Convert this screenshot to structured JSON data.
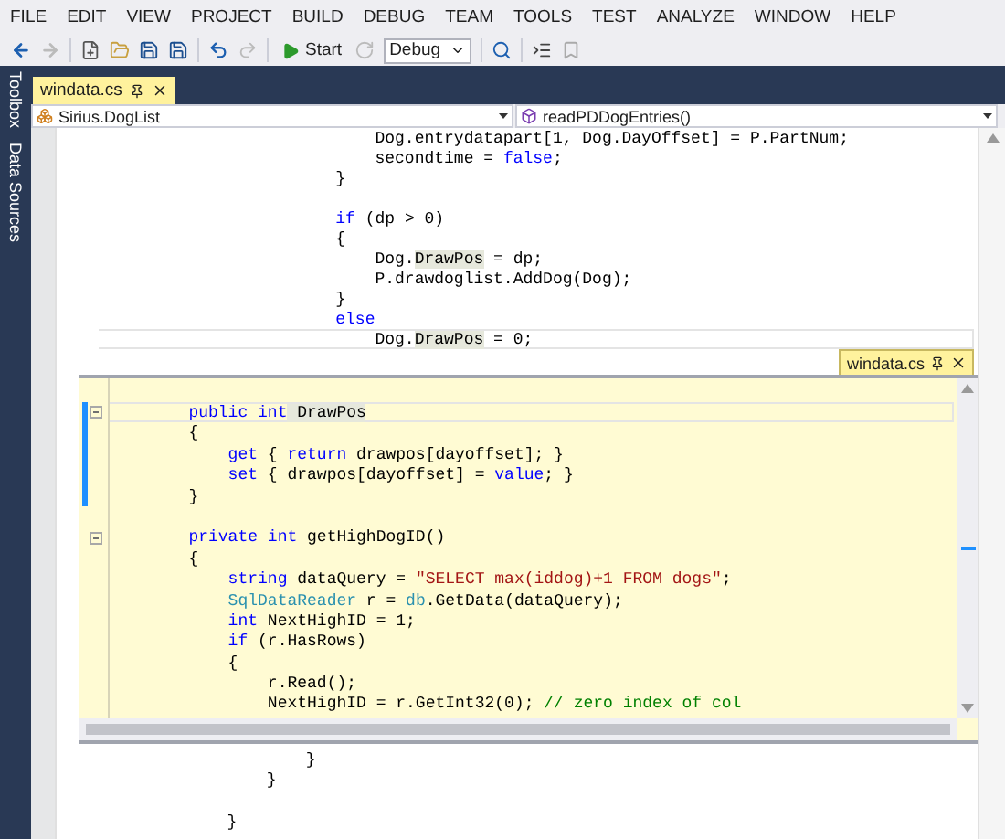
{
  "menu": [
    "FILE",
    "EDIT",
    "VIEW",
    "PROJECT",
    "BUILD",
    "DEBUG",
    "TEAM",
    "TOOLS",
    "TEST",
    "ANALYZE",
    "WINDOW",
    "HELP"
  ],
  "toolbar": {
    "start_label": "Start",
    "configuration": "Debug"
  },
  "side_tabs": [
    "Toolbox",
    "Data Sources"
  ],
  "document_tab": {
    "label": "windata.cs",
    "selected": true
  },
  "navigation": {
    "type": "Sirius.DogList",
    "member": "readPDDogEntries()"
  },
  "editor_lines": [
    {
      "current": false,
      "tokens": [
        {
          "text": "                            Dog.entrydatapart[1, Dog.DayOffset] = P.PartNum;",
          "kind": "plain"
        }
      ]
    },
    {
      "current": false,
      "tokens": [
        {
          "text": "                            secondtime = ",
          "kind": "plain"
        },
        {
          "text": "false",
          "kind": "keyword"
        },
        {
          "text": ";",
          "kind": "plain"
        }
      ]
    },
    {
      "current": false,
      "tokens": [
        {
          "text": "                        }",
          "kind": "plain"
        }
      ]
    },
    {
      "current": false
    },
    {
      "current": false,
      "tokens": [
        {
          "text": "                        if",
          "kind": "keyword"
        },
        {
          "text": " (dp > 0)",
          "kind": "plain"
        }
      ]
    },
    {
      "current": false,
      "tokens": [
        {
          "text": "                        {",
          "kind": "plain"
        }
      ]
    },
    {
      "current": false,
      "tokens": [
        {
          "text": "                            Dog.",
          "kind": "plain"
        },
        {
          "text": "DrawPos",
          "kind": "reference"
        },
        {
          "text": " = dp;",
          "kind": "plain"
        }
      ]
    },
    {
      "current": false,
      "tokens": [
        {
          "text": "                            P.drawdoglist.AddDog(Dog);",
          "kind": "plain"
        }
      ]
    },
    {
      "current": false,
      "tokens": [
        {
          "text": "                        }",
          "kind": "plain"
        }
      ]
    },
    {
      "current": false,
      "tokens": [
        {
          "text": "                        else",
          "kind": "keyword"
        }
      ]
    },
    {
      "current": true,
      "tokens": [
        {
          "text": "                            Dog.",
          "kind": "plain"
        },
        {
          "text": "DrawPos",
          "kind": "reference"
        },
        {
          "text": " = 0;",
          "kind": "plain"
        }
      ]
    }
  ],
  "peek": {
    "title": "windata.cs",
    "lines": [
      {
        "current": true,
        "changed": true,
        "expanded": true,
        "tokens": [
          {
            "text": "        public",
            "kind": "keyword"
          },
          {
            "text": " int",
            "kind": "keyword"
          },
          {
            "text": " DrawPos",
            "kind": "reference"
          }
        ]
      },
      {
        "current": false,
        "changed": true,
        "tokens": [
          {
            "text": "        {",
            "kind": "plain"
          }
        ]
      },
      {
        "current": false,
        "changed": true,
        "tokens": [
          {
            "text": "            get",
            "kind": "keyword"
          },
          {
            "text": " { ",
            "kind": "plain"
          },
          {
            "text": "return",
            "kind": "keyword"
          },
          {
            "text": " drawpos[dayoffset]; }",
            "kind": "plain"
          }
        ]
      },
      {
        "current": false,
        "changed": true,
        "tokens": [
          {
            "text": "            set",
            "kind": "keyword"
          },
          {
            "text": " { drawpos[dayoffset] = ",
            "kind": "plain"
          },
          {
            "text": "value",
            "kind": "keyword"
          },
          {
            "text": "; }",
            "kind": "plain"
          }
        ]
      },
      {
        "current": false,
        "changed": true,
        "tokens": [
          {
            "text": "        }",
            "kind": "plain"
          }
        ]
      },
      {
        "current": false,
        "changed": false
      },
      {
        "current": false,
        "changed": false,
        "expanded": true,
        "tokens": [
          {
            "text": "        private",
            "kind": "keyword"
          },
          {
            "text": " int",
            "kind": "keyword"
          },
          {
            "text": " getHighDogID()",
            "kind": "plain"
          }
        ]
      },
      {
        "current": false,
        "changed": false,
        "tokens": [
          {
            "text": "        {",
            "kind": "plain"
          }
        ]
      },
      {
        "current": false,
        "changed": false,
        "tokens": [
          {
            "text": "            string",
            "kind": "keyword"
          },
          {
            "text": " dataQuery = ",
            "kind": "plain"
          },
          {
            "text": "\"SELECT max(iddog)+1 FROM dogs\"",
            "kind": "string"
          },
          {
            "text": ";",
            "kind": "plain"
          }
        ]
      },
      {
        "current": false,
        "changed": false,
        "tokens": [
          {
            "text": "            SqlDataReader",
            "kind": "type"
          },
          {
            "text": " r = ",
            "kind": "plain"
          },
          {
            "text": "db",
            "kind": "type"
          },
          {
            "text": ".GetData(dataQuery);",
            "kind": "plain"
          }
        ]
      },
      {
        "current": false,
        "changed": false,
        "tokens": [
          {
            "text": "            int",
            "kind": "keyword"
          },
          {
            "text": " NextHighID = 1;",
            "kind": "plain"
          }
        ]
      },
      {
        "current": false,
        "changed": false,
        "tokens": [
          {
            "text": "            if",
            "kind": "keyword"
          },
          {
            "text": " (r.HasRows)",
            "kind": "plain"
          }
        ]
      },
      {
        "current": false,
        "changed": false,
        "tokens": [
          {
            "text": "            {",
            "kind": "plain"
          }
        ]
      },
      {
        "current": false,
        "changed": false,
        "tokens": [
          {
            "text": "                r.Read();",
            "kind": "plain"
          }
        ]
      },
      {
        "current": false,
        "changed": false,
        "tokens": [
          {
            "text": "                NextHighID = r.GetInt32(0); ",
            "kind": "plain"
          },
          {
            "text": "// zero index of col",
            "kind": "comment"
          }
        ]
      }
    ]
  },
  "bottom_lines": [
    {
      "current": false,
      "tokens": [
        {
          "text": "                     }",
          "kind": "plain"
        }
      ]
    },
    {
      "current": false,
      "tokens": [
        {
          "text": "                 }",
          "kind": "plain"
        }
      ]
    },
    {
      "current": false
    },
    {
      "current": false,
      "tokens": [
        {
          "text": "             }",
          "kind": "plain"
        }
      ]
    }
  ]
}
